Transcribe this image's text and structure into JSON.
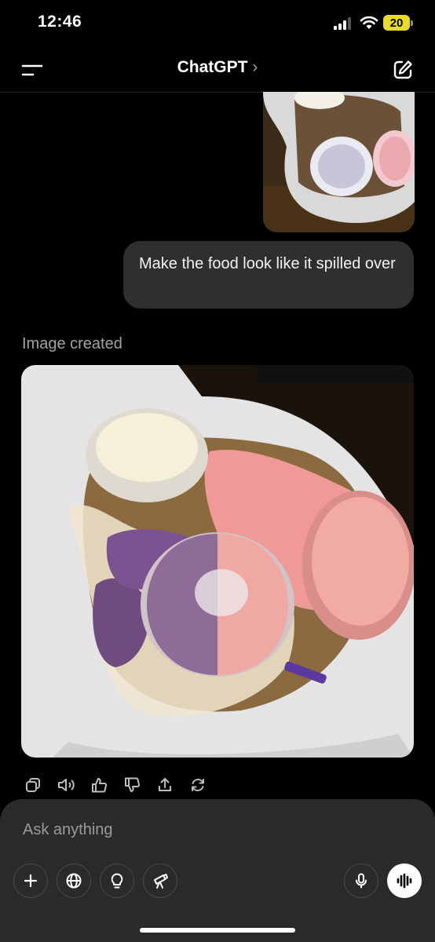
{
  "status_bar": {
    "time": "12:46",
    "battery": "20",
    "battery_color": "#e8d92a"
  },
  "header": {
    "title": "ChatGPT",
    "chevron": "›",
    "menu_icon": "menu-icon",
    "edit_icon": "new-chat-icon"
  },
  "conversation": {
    "user_message": "Make the food look like it spilled over",
    "assistant_label": "Image created"
  },
  "message_actions": [
    "copy-icon",
    "read-aloud-icon",
    "thumbs-up-icon",
    "thumbs-down-icon",
    "share-icon",
    "regenerate-icon"
  ],
  "composer": {
    "placeholder": "Ask anything",
    "tools": [
      "plus-icon",
      "globe-icon",
      "lightbulb-icon",
      "telescope-icon"
    ],
    "mic_icon": "microphone-icon",
    "voice_icon": "voice-mode-icon"
  },
  "colors": {
    "background": "#000000",
    "bubble": "#2f2f2f",
    "composer": "#2a2a2a",
    "muted_text": "#a3a3a3"
  }
}
